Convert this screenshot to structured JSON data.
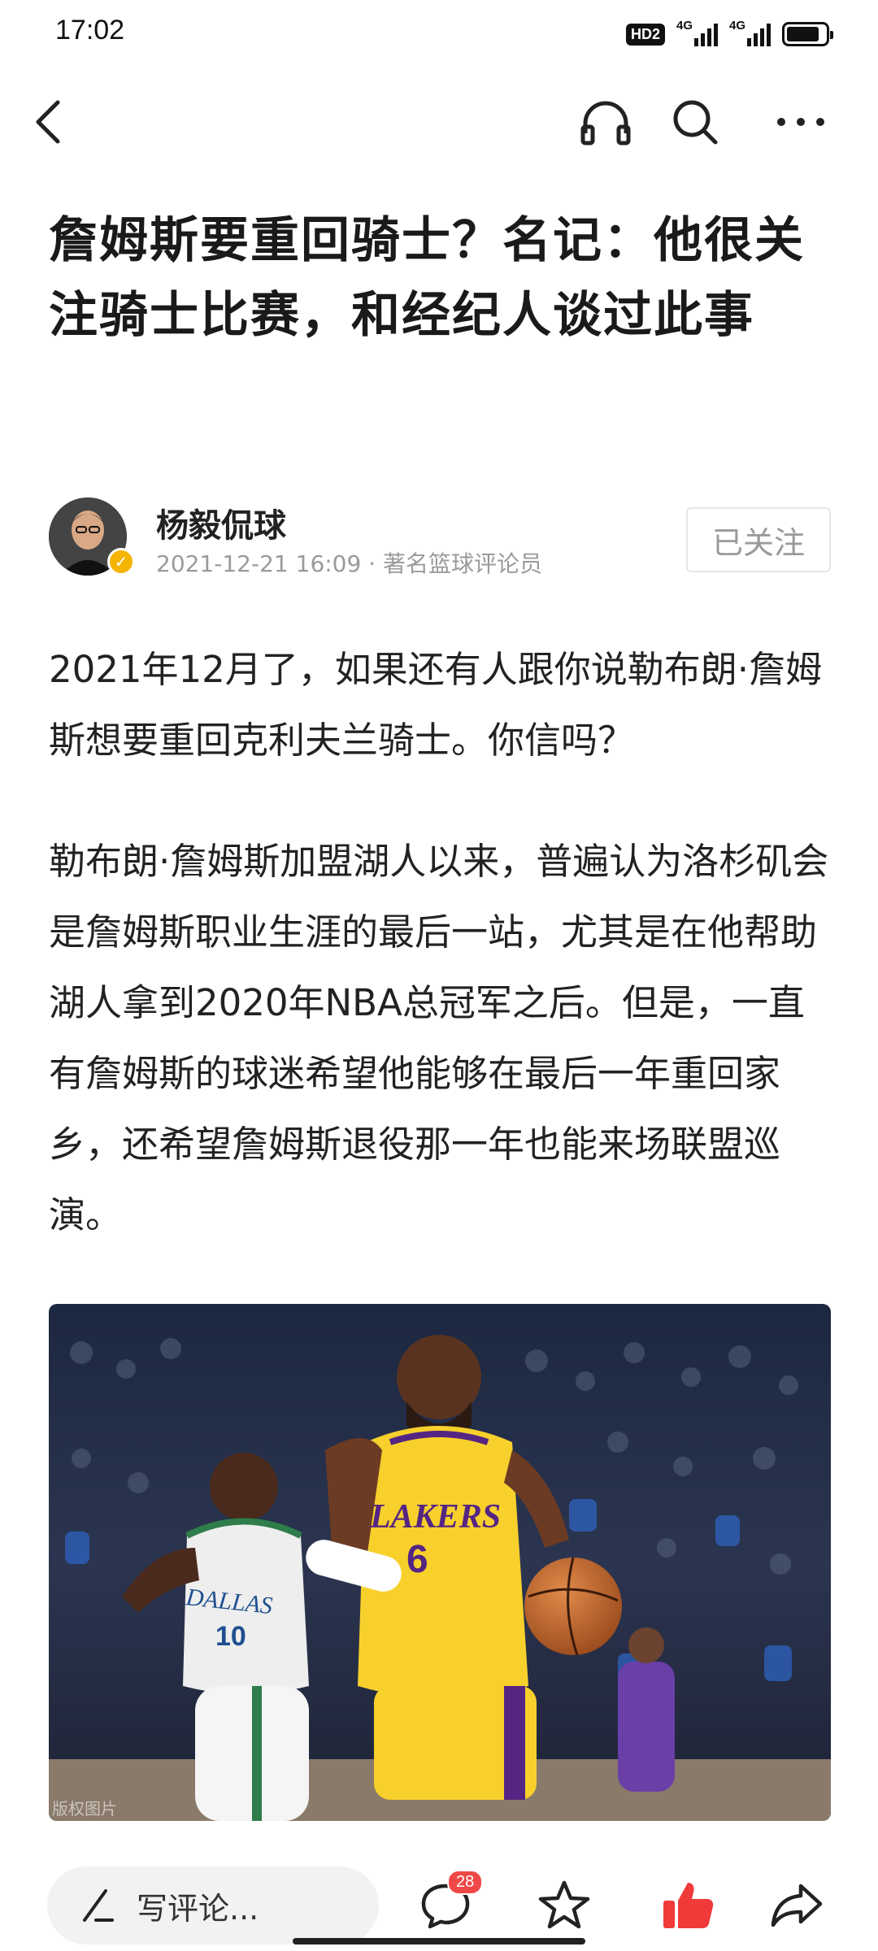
{
  "status_bar": {
    "time": "17:02",
    "hd_label": "HD2",
    "network_1": "4G",
    "network_2": "4G",
    "battery_level": 0.85
  },
  "nav": {
    "icons": [
      "back-arrow-icon",
      "headphones-icon",
      "search-icon",
      "more-icon"
    ]
  },
  "article": {
    "title": "詹姆斯要重回骑士？名记：他很关注骑士比赛，和经纪人谈过此事",
    "author": {
      "name": "杨毅侃球",
      "meta": "2021-12-21 16:09 · 著名篮球评论员",
      "verified": true,
      "follow_label": "已关注"
    },
    "paragraphs": [
      "2021年12月了，如果还有人跟你说勒布朗·詹姆斯想要重回克利夫兰骑士。你信吗？",
      "勒布朗·詹姆斯加盟湖人以来，普遍认为洛杉矶会是詹姆斯职业生涯的最后一站，尤其是在他帮助湖人拿到2020年NBA总冠军之后。但是，一直有詹姆斯的球迷希望他能够在最后一年重回家乡，还希望詹姆斯退役那一年也能来场联盟巡演。"
    ],
    "photo": {
      "jersey_left_text": "DALLAS",
      "jersey_left_number": "10",
      "jersey_right_text": "LAKERS",
      "jersey_right_number": "6",
      "watermark": "版权图片"
    }
  },
  "bottom_bar": {
    "comment_placeholder": "写评论...",
    "comment_count": "28",
    "liked": true,
    "colors": {
      "like": "#f03a3a",
      "badge": "#f04848"
    }
  }
}
